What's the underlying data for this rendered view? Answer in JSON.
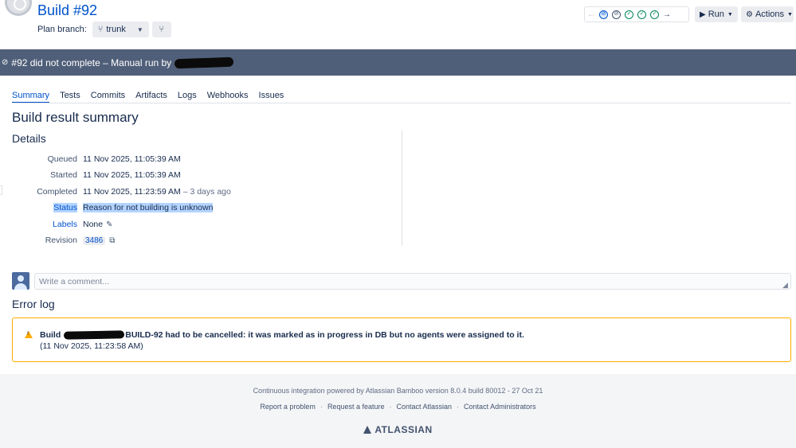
{
  "header": {
    "title": "Build #92",
    "plan_branch_label": "Plan branch:",
    "branch": "trunk",
    "run_label": "Run",
    "actions_label": "Actions"
  },
  "banner": {
    "text": "#92 did not complete – Manual run by"
  },
  "tabs": [
    "Summary",
    "Tests",
    "Commits",
    "Artifacts",
    "Logs",
    "Webhooks",
    "Issues"
  ],
  "summary": {
    "heading": "Build result summary",
    "details_heading": "Details",
    "rows": [
      {
        "label": "Queued",
        "value": "11 Nov 2025, 11:05:39 AM"
      },
      {
        "label": "Started",
        "value": "11 Nov 2025, 11:05:39 AM"
      },
      {
        "label": "Completed",
        "value": "11 Nov 2025, 11:23:59 AM",
        "suffix": "– 3 days ago"
      },
      {
        "label": "Status",
        "value": "Reason for not building is unknown"
      },
      {
        "label": "Labels",
        "value": "None"
      },
      {
        "label": "Revision",
        "value": "3486"
      }
    ]
  },
  "comment": {
    "placeholder": "Write a comment..."
  },
  "error_log": {
    "heading": "Error log",
    "line1_prefix": "Build",
    "line1_suffix": "BUILD-92 had to be cancelled: it was marked as in progress in DB but no agents were assigned to it.",
    "line2": "(11 Nov 2025, 11:23:58 AM)"
  },
  "footer": {
    "powered": "Continuous integration powered by Atlassian Bamboo version 8.0.4 build 80012 - 27 Oct 21",
    "links": [
      "Report a problem",
      "Request a feature",
      "Contact Atlassian",
      "Contact Administrators"
    ],
    "logo": "ATLASSIAN"
  },
  "colors": {
    "link": "#0052cc",
    "banner": "#505f79",
    "warning": "#ffab00",
    "success": "#00875a"
  }
}
